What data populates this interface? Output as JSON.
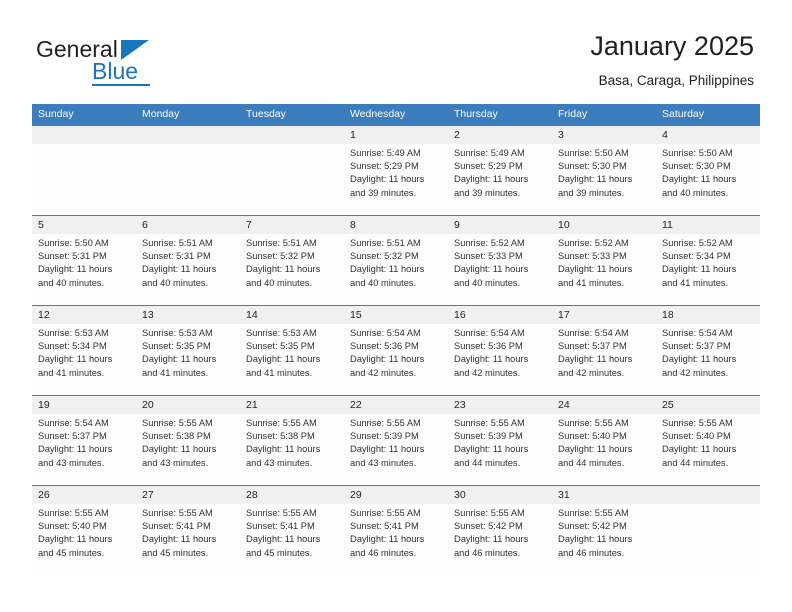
{
  "brand": {
    "name_top": "General",
    "name_bottom": "Blue",
    "triangle_color": "#1b75bb",
    "text_color": "#231f20",
    "accent_color": "#1b75bb"
  },
  "header": {
    "title": "January 2025",
    "subtitle": "Basa, Caraga, Philippines"
  },
  "theme": {
    "header_blue": "#3b7dbd",
    "daynum_band": "#f0f0f0",
    "cell_background": "#fdfdfd",
    "text": "#231f20"
  },
  "weekdays": [
    "Sunday",
    "Monday",
    "Tuesday",
    "Wednesday",
    "Thursday",
    "Friday",
    "Saturday"
  ],
  "weeks": [
    {
      "days": [
        {
          "date": "",
          "sunrise": "",
          "sunset": "",
          "daylight_line1": "",
          "daylight_line2": ""
        },
        {
          "date": "",
          "sunrise": "",
          "sunset": "",
          "daylight_line1": "",
          "daylight_line2": ""
        },
        {
          "date": "",
          "sunrise": "",
          "sunset": "",
          "daylight_line1": "",
          "daylight_line2": ""
        },
        {
          "date": "1",
          "sunrise": "Sunrise: 5:49 AM",
          "sunset": "Sunset: 5:29 PM",
          "daylight_line1": "Daylight: 11 hours",
          "daylight_line2": "and 39 minutes."
        },
        {
          "date": "2",
          "sunrise": "Sunrise: 5:49 AM",
          "sunset": "Sunset: 5:29 PM",
          "daylight_line1": "Daylight: 11 hours",
          "daylight_line2": "and 39 minutes."
        },
        {
          "date": "3",
          "sunrise": "Sunrise: 5:50 AM",
          "sunset": "Sunset: 5:30 PM",
          "daylight_line1": "Daylight: 11 hours",
          "daylight_line2": "and 39 minutes."
        },
        {
          "date": "4",
          "sunrise": "Sunrise: 5:50 AM",
          "sunset": "Sunset: 5:30 PM",
          "daylight_line1": "Daylight: 11 hours",
          "daylight_line2": "and 40 minutes."
        }
      ]
    },
    {
      "days": [
        {
          "date": "5",
          "sunrise": "Sunrise: 5:50 AM",
          "sunset": "Sunset: 5:31 PM",
          "daylight_line1": "Daylight: 11 hours",
          "daylight_line2": "and 40 minutes."
        },
        {
          "date": "6",
          "sunrise": "Sunrise: 5:51 AM",
          "sunset": "Sunset: 5:31 PM",
          "daylight_line1": "Daylight: 11 hours",
          "daylight_line2": "and 40 minutes."
        },
        {
          "date": "7",
          "sunrise": "Sunrise: 5:51 AM",
          "sunset": "Sunset: 5:32 PM",
          "daylight_line1": "Daylight: 11 hours",
          "daylight_line2": "and 40 minutes."
        },
        {
          "date": "8",
          "sunrise": "Sunrise: 5:51 AM",
          "sunset": "Sunset: 5:32 PM",
          "daylight_line1": "Daylight: 11 hours",
          "daylight_line2": "and 40 minutes."
        },
        {
          "date": "9",
          "sunrise": "Sunrise: 5:52 AM",
          "sunset": "Sunset: 5:33 PM",
          "daylight_line1": "Daylight: 11 hours",
          "daylight_line2": "and 40 minutes."
        },
        {
          "date": "10",
          "sunrise": "Sunrise: 5:52 AM",
          "sunset": "Sunset: 5:33 PM",
          "daylight_line1": "Daylight: 11 hours",
          "daylight_line2": "and 41 minutes."
        },
        {
          "date": "11",
          "sunrise": "Sunrise: 5:52 AM",
          "sunset": "Sunset: 5:34 PM",
          "daylight_line1": "Daylight: 11 hours",
          "daylight_line2": "and 41 minutes."
        }
      ]
    },
    {
      "days": [
        {
          "date": "12",
          "sunrise": "Sunrise: 5:53 AM",
          "sunset": "Sunset: 5:34 PM",
          "daylight_line1": "Daylight: 11 hours",
          "daylight_line2": "and 41 minutes."
        },
        {
          "date": "13",
          "sunrise": "Sunrise: 5:53 AM",
          "sunset": "Sunset: 5:35 PM",
          "daylight_line1": "Daylight: 11 hours",
          "daylight_line2": "and 41 minutes."
        },
        {
          "date": "14",
          "sunrise": "Sunrise: 5:53 AM",
          "sunset": "Sunset: 5:35 PM",
          "daylight_line1": "Daylight: 11 hours",
          "daylight_line2": "and 41 minutes."
        },
        {
          "date": "15",
          "sunrise": "Sunrise: 5:54 AM",
          "sunset": "Sunset: 5:36 PM",
          "daylight_line1": "Daylight: 11 hours",
          "daylight_line2": "and 42 minutes."
        },
        {
          "date": "16",
          "sunrise": "Sunrise: 5:54 AM",
          "sunset": "Sunset: 5:36 PM",
          "daylight_line1": "Daylight: 11 hours",
          "daylight_line2": "and 42 minutes."
        },
        {
          "date": "17",
          "sunrise": "Sunrise: 5:54 AM",
          "sunset": "Sunset: 5:37 PM",
          "daylight_line1": "Daylight: 11 hours",
          "daylight_line2": "and 42 minutes."
        },
        {
          "date": "18",
          "sunrise": "Sunrise: 5:54 AM",
          "sunset": "Sunset: 5:37 PM",
          "daylight_line1": "Daylight: 11 hours",
          "daylight_line2": "and 42 minutes."
        }
      ]
    },
    {
      "days": [
        {
          "date": "19",
          "sunrise": "Sunrise: 5:54 AM",
          "sunset": "Sunset: 5:37 PM",
          "daylight_line1": "Daylight: 11 hours",
          "daylight_line2": "and 43 minutes."
        },
        {
          "date": "20",
          "sunrise": "Sunrise: 5:55 AM",
          "sunset": "Sunset: 5:38 PM",
          "daylight_line1": "Daylight: 11 hours",
          "daylight_line2": "and 43 minutes."
        },
        {
          "date": "21",
          "sunrise": "Sunrise: 5:55 AM",
          "sunset": "Sunset: 5:38 PM",
          "daylight_line1": "Daylight: 11 hours",
          "daylight_line2": "and 43 minutes."
        },
        {
          "date": "22",
          "sunrise": "Sunrise: 5:55 AM",
          "sunset": "Sunset: 5:39 PM",
          "daylight_line1": "Daylight: 11 hours",
          "daylight_line2": "and 43 minutes."
        },
        {
          "date": "23",
          "sunrise": "Sunrise: 5:55 AM",
          "sunset": "Sunset: 5:39 PM",
          "daylight_line1": "Daylight: 11 hours",
          "daylight_line2": "and 44 minutes."
        },
        {
          "date": "24",
          "sunrise": "Sunrise: 5:55 AM",
          "sunset": "Sunset: 5:40 PM",
          "daylight_line1": "Daylight: 11 hours",
          "daylight_line2": "and 44 minutes."
        },
        {
          "date": "25",
          "sunrise": "Sunrise: 5:55 AM",
          "sunset": "Sunset: 5:40 PM",
          "daylight_line1": "Daylight: 11 hours",
          "daylight_line2": "and 44 minutes."
        }
      ]
    },
    {
      "days": [
        {
          "date": "26",
          "sunrise": "Sunrise: 5:55 AM",
          "sunset": "Sunset: 5:40 PM",
          "daylight_line1": "Daylight: 11 hours",
          "daylight_line2": "and 45 minutes."
        },
        {
          "date": "27",
          "sunrise": "Sunrise: 5:55 AM",
          "sunset": "Sunset: 5:41 PM",
          "daylight_line1": "Daylight: 11 hours",
          "daylight_line2": "and 45 minutes."
        },
        {
          "date": "28",
          "sunrise": "Sunrise: 5:55 AM",
          "sunset": "Sunset: 5:41 PM",
          "daylight_line1": "Daylight: 11 hours",
          "daylight_line2": "and 45 minutes."
        },
        {
          "date": "29",
          "sunrise": "Sunrise: 5:55 AM",
          "sunset": "Sunset: 5:41 PM",
          "daylight_line1": "Daylight: 11 hours",
          "daylight_line2": "and 46 minutes."
        },
        {
          "date": "30",
          "sunrise": "Sunrise: 5:55 AM",
          "sunset": "Sunset: 5:42 PM",
          "daylight_line1": "Daylight: 11 hours",
          "daylight_line2": "and 46 minutes."
        },
        {
          "date": "31",
          "sunrise": "Sunrise: 5:55 AM",
          "sunset": "Sunset: 5:42 PM",
          "daylight_line1": "Daylight: 11 hours",
          "daylight_line2": "and 46 minutes."
        },
        {
          "date": "",
          "sunrise": "",
          "sunset": "",
          "daylight_line1": "",
          "daylight_line2": ""
        }
      ]
    }
  ]
}
